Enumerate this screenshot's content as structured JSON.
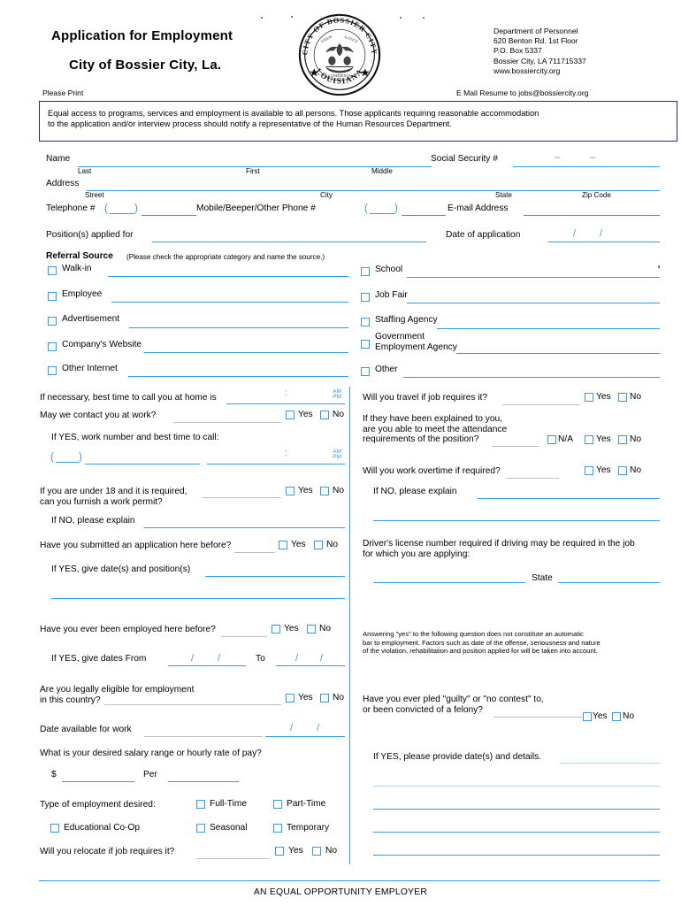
{
  "header": {
    "title_line1": "Application for Employment",
    "title_line2": "City of Bossier City, La.",
    "seal": {
      "top_arc": "CITY OF BOSSIER CITY",
      "bottom_arc": "LOUISIANA",
      "inner_left": "UNION",
      "inner_center": "JUSTICE",
      "inner_bottom": "CONFIDENCE"
    },
    "department": [
      "Department of Personnel",
      "620 Benton Rd. 1st Floor",
      "P.O. Box 5337",
      "Bossier City, LA 711715337",
      "www.bossiercity.org"
    ],
    "please_print": "Please Print",
    "email_resume": "E Mail Resume to jobs@bossiercity.org"
  },
  "notice": {
    "line1": "Equal access to programs, services and employment is available to all persons. Those applicants requiring reasonable accommodation",
    "line2": "to the application and/or interview process should notify a representative of the Human Resources Department."
  },
  "personal": {
    "name_label": "Name",
    "name_sub_last": "Last",
    "name_sub_first": "First",
    "name_sub_middle": "Middle",
    "ssn_label": "Social Security #",
    "address_label": "Address",
    "address_sub_street": "Street",
    "address_sub_city": "City",
    "address_sub_state": "State",
    "address_sub_zip": "Zip Code",
    "telephone_label": "Telephone #",
    "mobile_label": "Mobile/Beeper/Other Phone #",
    "email_label": "E-mail Address",
    "position_label": "Position(s) applied for",
    "date_application_label": "Date of application"
  },
  "referral": {
    "heading": "Referral Source",
    "instruction": "(Please check the appropriate category and name the source.)",
    "left_items": [
      {
        "label": "Walk-in"
      },
      {
        "label": "Employee"
      },
      {
        "label": "Advertisement"
      },
      {
        "label": "Company's Website"
      },
      {
        "label": "Other Internet"
      }
    ],
    "right_items": [
      {
        "label": "School"
      },
      {
        "label": "Job Fair"
      },
      {
        "label": "Staffing Agency"
      },
      {
        "label_line1": "Government",
        "label_line2": "Employment Agency"
      },
      {
        "label": "Other"
      }
    ]
  },
  "left_column": {
    "best_time_home": "If necessary, best time to call you at home is",
    "contact_at_work": "May we contact you at work?",
    "if_yes_work_number": "If YES, work number and best time to call:",
    "under_18_line1": "If you are under 18 and it is required,",
    "under_18_line2": "can you furnish a work permit?",
    "if_no_explain": "If NO, please explain",
    "submitted_before": "Have you submitted an application here before?",
    "if_yes_dates_positions": "If YES, give date(s) and position(s)",
    "employed_before": "Have you ever been employed here before?",
    "if_yes_give_dates": "If YES, give dates  From",
    "to_label": "To",
    "legally_eligible_line1": "Are you legally eligible for employment",
    "legally_eligible_line2": "in this country?",
    "date_available": "Date available for work",
    "desired_salary": "What is your desired salary range or hourly rate of pay?",
    "dollar_sign": "$",
    "per_label": "Per",
    "employment_type_label": "Type of employment desired:",
    "employment_types": [
      "Full-Time",
      "Part-Time",
      "Educational Co-Op",
      "Seasonal",
      "Temporary"
    ],
    "relocate": "Will you relocate if job requires it?",
    "yes_label": "Yes",
    "no_label": "No",
    "am_label": "AM",
    "pm_label": "PM"
  },
  "right_column": {
    "travel": "Will you travel if job requires it?",
    "attendance_line1": "If they have been explained to you,",
    "attendance_line2": "are you able to meet the attendance",
    "attendance_line3": "requirements of the position?",
    "na_label": "N/A",
    "overtime": "Will you work overtime if required?",
    "if_no_explain": "If NO, please explain",
    "drivers_license_line1": "Driver's license number required if driving may be required in the job",
    "drivers_license_line2": "for which you are applying:",
    "state_label": "State",
    "felony_notice_line1": "Answering \"yes\" to the following question does not constitute an automatic",
    "felony_notice_line2": "bar to employment. Factors such as date of the offense, seriousness and nature",
    "felony_notice_line3": "of the violation, rehabilitation and position applied for will be taken into account.",
    "felony_q_line1": "Have you ever pled \"guilty\" or \"no contest\" to,",
    "felony_q_line2": "or been convicted of a felony?",
    "if_yes_details": "If YES, please provide date(s) and details.",
    "yes_label": "Yes",
    "no_label": "No"
  },
  "footer": {
    "text": "AN EQUAL OPPORTUNITY EMPLOYER"
  },
  "colors": {
    "rule_blue": "#3399ee",
    "notice_border": "#2222cc",
    "text_black": "#000000"
  }
}
